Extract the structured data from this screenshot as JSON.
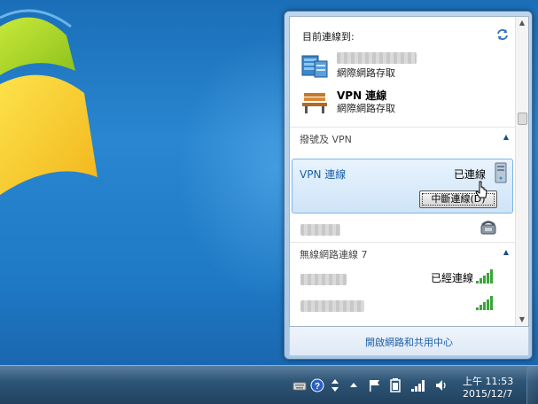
{
  "flyout": {
    "current_header": "目前連線到:",
    "connected_networks": [
      {
        "name": "",
        "access": "網際網路存取",
        "icon": "network-icon"
      },
      {
        "name": "VPN 連線",
        "access": "網際網路存取",
        "icon": "bench-icon"
      }
    ],
    "dialup_section": {
      "title": "撥號及 VPN",
      "vpn": {
        "name": "VPN 連線",
        "status": "已連線",
        "button": "中斷連線(D)"
      }
    },
    "wireless_section": {
      "title": "無線網路連線 7",
      "networks": [
        {
          "status": "已經連線",
          "signal": 5
        },
        {
          "status": "",
          "signal": 5
        }
      ]
    },
    "footer_link": "開啟網路和共用中心"
  },
  "taskbar": {
    "clock_time": "上午 11:53",
    "clock_date": "2015/12/7"
  },
  "colors": {
    "accent": "#1c5fa8",
    "taskbar": "#2f5576",
    "desktop": "#1f79c4"
  }
}
